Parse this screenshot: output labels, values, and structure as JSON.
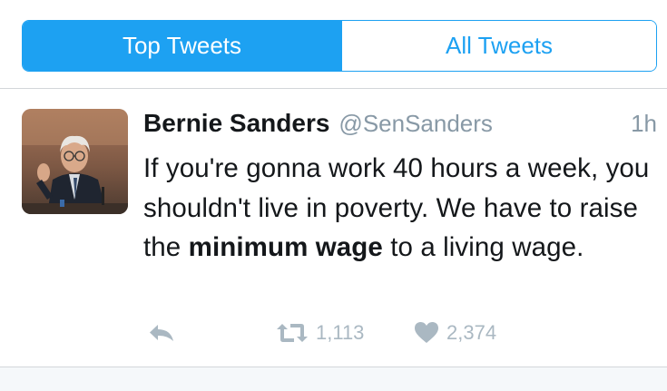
{
  "tabs": {
    "top_label": "Top Tweets",
    "all_label": "All Tweets",
    "selected": "Top Tweets"
  },
  "tweet": {
    "display_name": "Bernie Sanders",
    "handle": "@SenSanders",
    "time": "1h",
    "text_part1": "If you're gonna work 40 hours a week, you shouldn't live in poverty. We have to raise the ",
    "text_bold1": "minimum",
    "text_bold2": "wage",
    "text_part2": " to a living wage.",
    "retweets": "1,113",
    "likes": "2,374"
  },
  "icons": {
    "reply": "reply-icon",
    "retweet": "retweet-icon",
    "like": "heart-icon"
  },
  "colors": {
    "accent": "#1da1f2",
    "text": "#14171a",
    "muted": "#8899a6",
    "action": "#aab8c2"
  }
}
